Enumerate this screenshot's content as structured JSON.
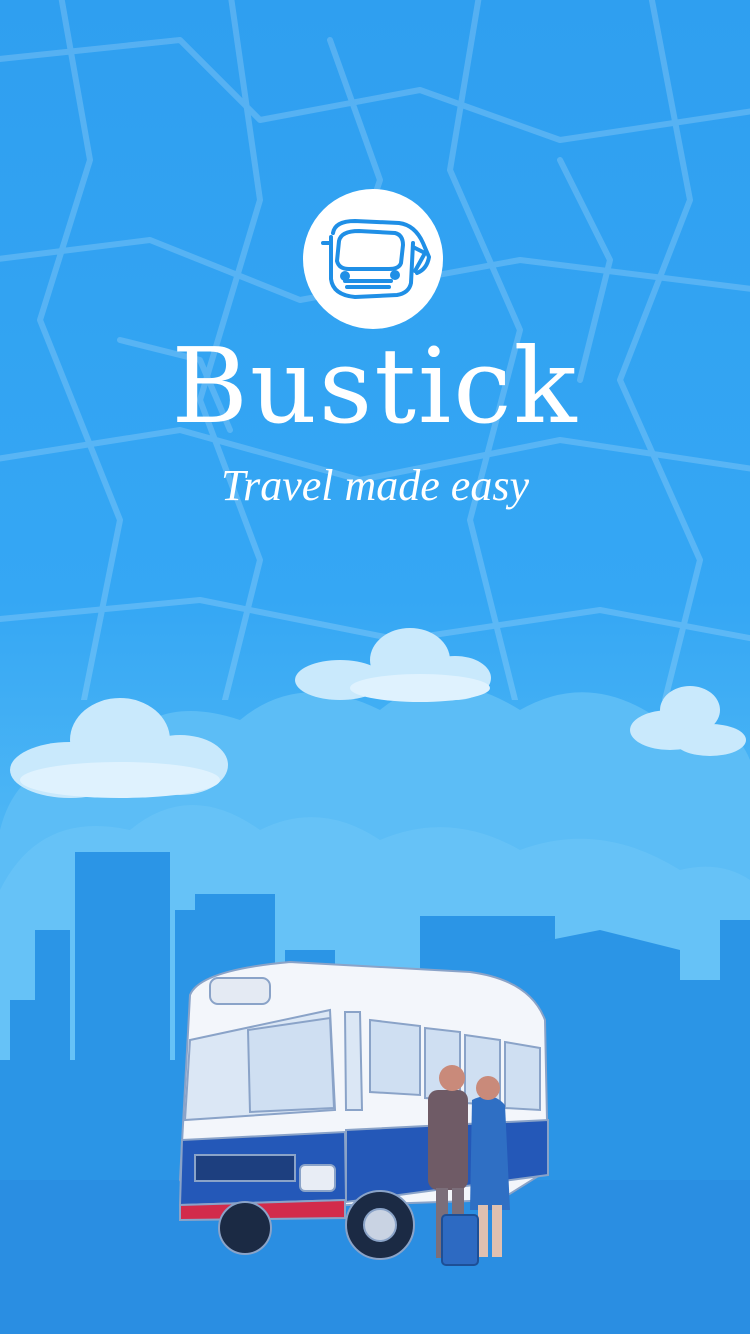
{
  "splash": {
    "app_name": "Bustick",
    "tagline": "Travel made easy"
  },
  "icons": {
    "logo": "bus-front-icon"
  },
  "colors": {
    "background": "#2ea3f2",
    "logo_circle": "#ffffff",
    "logo_stroke": "#1f8fe6",
    "skyline": "#248ee3",
    "bus_blue": "#2458b8",
    "bus_stripe": "#d22b4b"
  }
}
